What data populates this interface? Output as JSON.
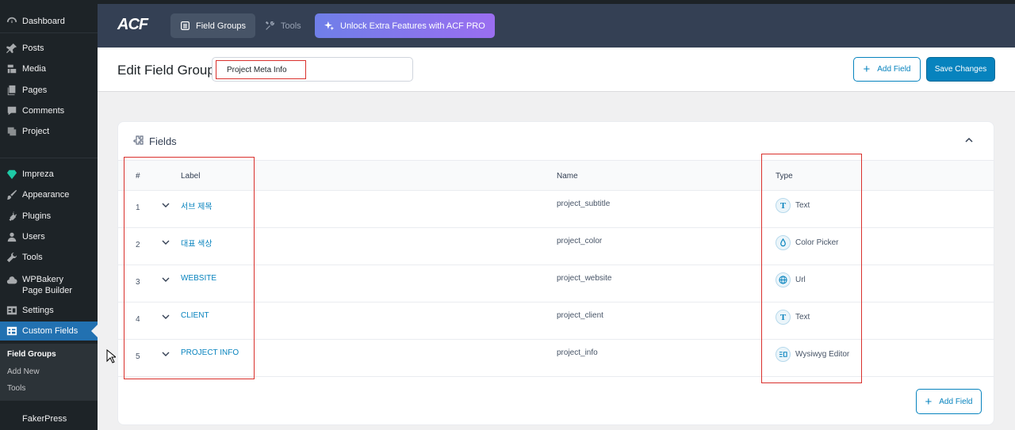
{
  "sidebar": {
    "items": [
      {
        "label": "Dashboard",
        "icon": "dashboard-icon"
      },
      {
        "label": "Posts",
        "icon": "pin-icon"
      },
      {
        "label": "Media",
        "icon": "media-icon"
      },
      {
        "label": "Pages",
        "icon": "pages-icon"
      },
      {
        "label": "Comments",
        "icon": "comment-icon"
      },
      {
        "label": "Project",
        "icon": "project-icon"
      },
      {
        "label": "Impreza",
        "icon": "diamond-icon"
      },
      {
        "label": "Appearance",
        "icon": "brush-icon"
      },
      {
        "label": "Plugins",
        "icon": "plug-icon"
      },
      {
        "label": "Users",
        "icon": "user-icon"
      },
      {
        "label": "Tools",
        "icon": "wrench-icon"
      },
      {
        "label": "WPBakery Page Builder",
        "icon": "cloud-icon"
      },
      {
        "label": "Settings",
        "icon": "settings-icon"
      },
      {
        "label": "Custom Fields",
        "icon": "table-icon"
      }
    ],
    "submenu": [
      "Field Groups",
      "Add New",
      "Tools"
    ],
    "faker": "FakerPress"
  },
  "topbar": {
    "logo": "ACF",
    "field_groups": "Field Groups",
    "tools": "Tools",
    "pro": "Unlock Extra Features with ACF PRO"
  },
  "header": {
    "title": "Edit Field Group",
    "group_name": "Project Meta Info",
    "add_field": "Add Field",
    "save": "Save Changes"
  },
  "fields": {
    "title": "Fields",
    "columns": {
      "num": "#",
      "label": "Label",
      "name": "Name",
      "type": "Type"
    },
    "rows": [
      {
        "num": "1",
        "label": "서브 제목",
        "name": "project_subtitle",
        "type": "Text",
        "icon": "text-type-icon"
      },
      {
        "num": "2",
        "label": "대표 색상",
        "name": "project_color",
        "type": "Color Picker",
        "icon": "color-picker-icon"
      },
      {
        "num": "3",
        "label": "WEBSITE",
        "name": "project_website",
        "type": "Url",
        "icon": "globe-icon"
      },
      {
        "num": "4",
        "label": "CLIENT",
        "name": "project_client",
        "type": "Text",
        "icon": "text-type-icon"
      },
      {
        "num": "5",
        "label": "PROJECT INFO",
        "name": "project_info",
        "type": "Wysiwyg Editor",
        "icon": "wysiwyg-icon"
      }
    ],
    "add_field": "Add Field"
  },
  "colors": {
    "accent": "#0783be",
    "sidebar_bg": "#1d2327",
    "topbar_bg": "#344054",
    "highlight": "#d9302c"
  }
}
